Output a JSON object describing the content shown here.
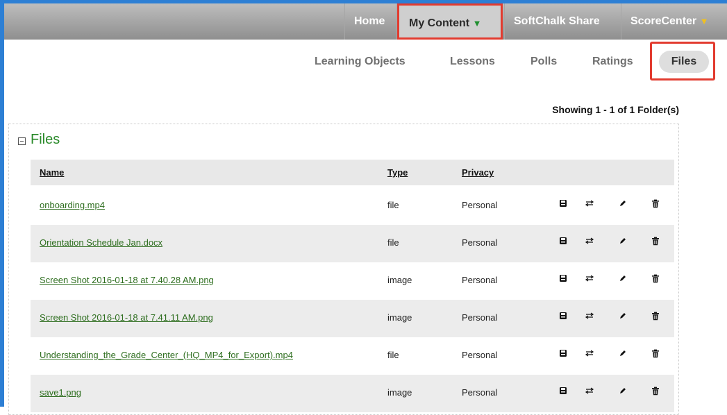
{
  "topnav": {
    "home": "Home",
    "my_content": "My Content",
    "softchalk_share": "SoftChalk Share",
    "scorecenter": "ScoreCenter"
  },
  "subnav": {
    "learning_objects": "Learning Objects",
    "lessons": "Lessons",
    "polls": "Polls",
    "ratings": "Ratings",
    "files": "Files"
  },
  "showing": "Showing 1 - 1 of 1 Folder(s)",
  "section_title": "Files",
  "table": {
    "headers": {
      "name": "Name",
      "type": "Type",
      "privacy": "Privacy"
    },
    "rows": [
      {
        "name": "onboarding.mp4",
        "type": "file",
        "privacy": "Personal"
      },
      {
        "name": "Orientation Schedule Jan.docx",
        "type": "file",
        "privacy": "Personal"
      },
      {
        "name": "Screen Shot 2016-01-18 at 7.40.28 AM.png",
        "type": "image",
        "privacy": "Personal"
      },
      {
        "name": "Screen Shot 2016-01-18 at 7.41.11 AM.png",
        "type": "image",
        "privacy": "Personal"
      },
      {
        "name": "Understanding_the_Grade_Center_(HQ_MP4_for_Export).mp4",
        "type": "file",
        "privacy": "Personal"
      },
      {
        "name": "save1.png",
        "type": "image",
        "privacy": "Personal"
      }
    ]
  },
  "colors": {
    "link_green": "#2e6e1f",
    "heading_green": "#2a8a2a",
    "highlight_red": "#e23b2f",
    "frame_blue": "#2d7fd4"
  },
  "icons": [
    "save-icon",
    "move-icon",
    "edit-icon",
    "delete-icon"
  ]
}
